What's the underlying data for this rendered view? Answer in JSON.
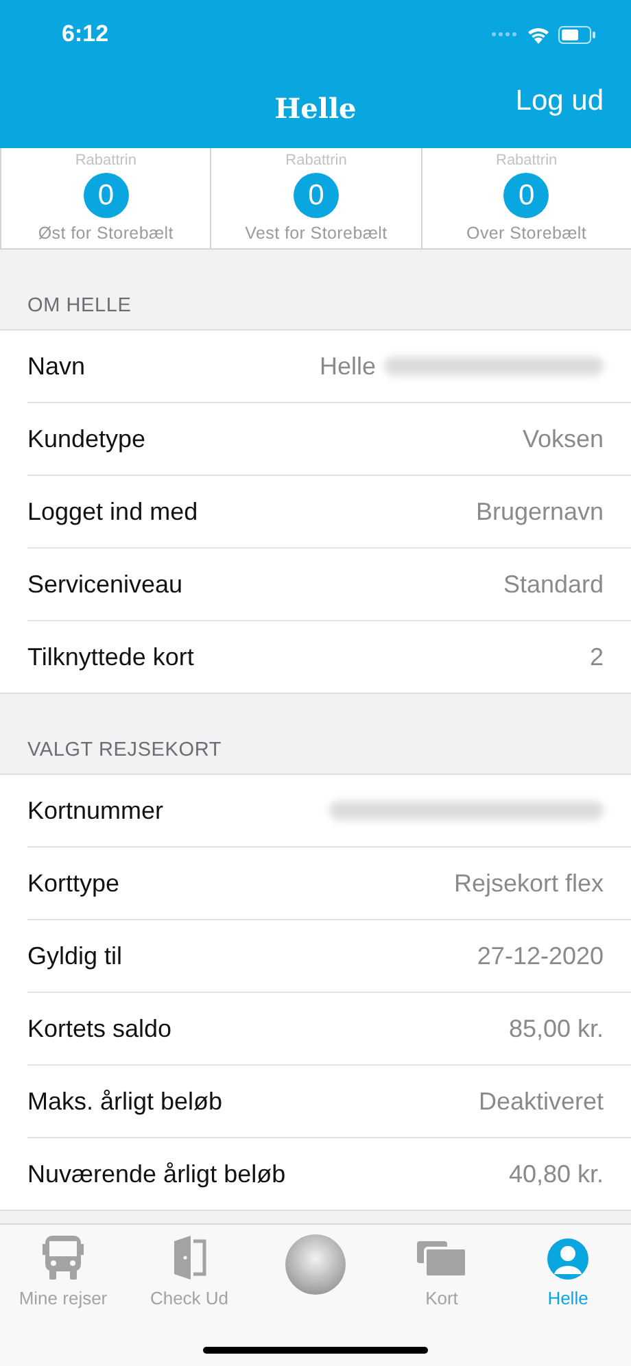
{
  "status_bar": {
    "time": "6:12"
  },
  "nav": {
    "title": "Helle",
    "action": "Log ud"
  },
  "discounts": [
    {
      "label": "Rabattrin",
      "value": "0",
      "zone": "Øst for Storebælt"
    },
    {
      "label": "Rabattrin",
      "value": "0",
      "zone": "Vest for Storebælt"
    },
    {
      "label": "Rabattrin",
      "value": "0",
      "zone": "Over Storebælt"
    }
  ],
  "sections": [
    {
      "header": "OM HELLE",
      "rows": [
        {
          "label": "Navn",
          "value": "Helle",
          "redacted": true
        },
        {
          "label": "Kundetype",
          "value": "Voksen",
          "redacted": false
        },
        {
          "label": "Logget ind med",
          "value": "Brugernavn",
          "redacted": false
        },
        {
          "label": "Serviceniveau",
          "value": "Standard",
          "redacted": false
        },
        {
          "label": "Tilknyttede kort",
          "value": "2",
          "redacted": false
        }
      ]
    },
    {
      "header": "VALGT REJSEKORT",
      "rows": [
        {
          "label": "Kortnummer",
          "redacted": true
        },
        {
          "label": "Korttype",
          "value": "Rejsekort flex",
          "redacted": false
        },
        {
          "label": "Gyldig til",
          "value": "27-12-2020",
          "redacted": false
        },
        {
          "label": "Kortets saldo",
          "value": "85,00 kr.",
          "redacted": false
        },
        {
          "label": "Maks. årligt beløb",
          "value": "Deaktiveret",
          "redacted": false
        },
        {
          "label": "Nuværende årligt beløb",
          "value": "40,80 kr.",
          "redacted": false
        }
      ]
    }
  ],
  "tab_bar": [
    {
      "kind": "bus",
      "label": "Mine rejser",
      "selected": false
    },
    {
      "kind": "door",
      "label": "Check Ud",
      "selected": false
    },
    {
      "kind": "orb",
      "selected": false
    },
    {
      "kind": "cards",
      "label": "Kort",
      "selected": false
    },
    {
      "kind": "person",
      "label": "Helle",
      "selected": true
    }
  ]
}
